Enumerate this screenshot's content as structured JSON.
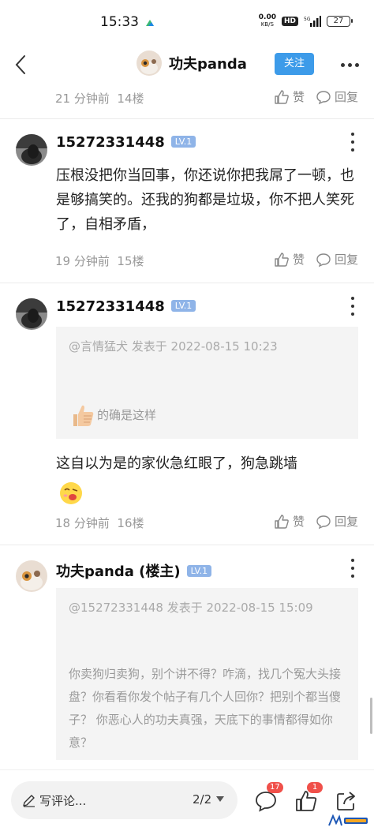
{
  "status": {
    "time": "15:33",
    "net_speed": "0.00",
    "net_unit": "KB/S",
    "hd": "HD",
    "signal": "5G",
    "battery": "27"
  },
  "header": {
    "title": "功夫panda",
    "follow_label": "关注"
  },
  "top_post": {
    "time": "21 分钟前",
    "floor": "14楼",
    "like": "赞",
    "reply": "回复"
  },
  "posts": [
    {
      "author": "15272331448",
      "level": "LV.1",
      "body": "压根没把你当回事，你还说你把我屌了一顿，也是够搞笑的。还我的狗都是垃圾，你不把人笑死了，自相矛盾，",
      "time": "19 分钟前",
      "floor": "15楼",
      "like": "赞",
      "reply": "回复"
    },
    {
      "author": "15272331448",
      "level": "LV.1",
      "quote_head": "@言情猛犬 发表于 2022-08-15 10:23",
      "quote_body": "的确是这样",
      "body": "这自以为是的家伙急红眼了，狗急跳墙",
      "time": "18 分钟前",
      "floor": "16楼",
      "like": "赞",
      "reply": "回复"
    },
    {
      "author": "功夫panda (楼主)",
      "level": "LV.1",
      "quote_head": "@15272331448 发表于 2022-08-15 15:09",
      "quote_body": "你卖狗归卖狗，别个讲不得？咋滴，找几个冤大头接盘？你看看你发个帖子有几个人回你？把别个都当傻子？ 你恶心人的功夫真强，天底下的事情都得如你意？"
    }
  ],
  "bottom": {
    "comment_placeholder": "写评论...",
    "page_indicator": "2/2",
    "comment_count": "17",
    "like_count": "1"
  },
  "colors": {
    "accent": "#3d9be9",
    "level_badge": "#8fb4e8",
    "badge_red": "#f0504a",
    "meta_gray": "#999999"
  },
  "icons": [
    "back-arrow-icon",
    "more-icon",
    "thumb-up-icon",
    "reply-bubble-icon",
    "kebab-icon",
    "pencil-icon",
    "chevron-down-icon",
    "comment-icon",
    "share-icon"
  ]
}
